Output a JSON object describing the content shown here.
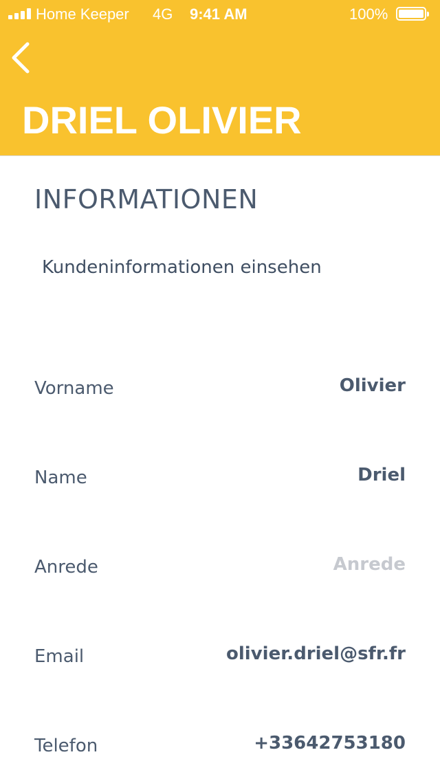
{
  "status_bar": {
    "carrier": "Home Keeper",
    "network": "4G",
    "time": "9:41 AM",
    "battery": "100%"
  },
  "header": {
    "back_icon": "chevron-left-icon",
    "title": "DRIEL OLIVIER",
    "background_color": "#F9C22E"
  },
  "section": {
    "title": "INFORMATIONEN",
    "subtitle": "Kundeninformationen einsehen"
  },
  "fields": [
    {
      "label": "Vorname",
      "value": "Olivier"
    },
    {
      "label": "Name",
      "value": "Driel"
    },
    {
      "label": "Anrede",
      "value": "",
      "placeholder": "Anrede"
    },
    {
      "label": "Email",
      "value": "olivier.driel@sfr.fr"
    },
    {
      "label": "Telefon",
      "value": "+33642753180"
    }
  ]
}
